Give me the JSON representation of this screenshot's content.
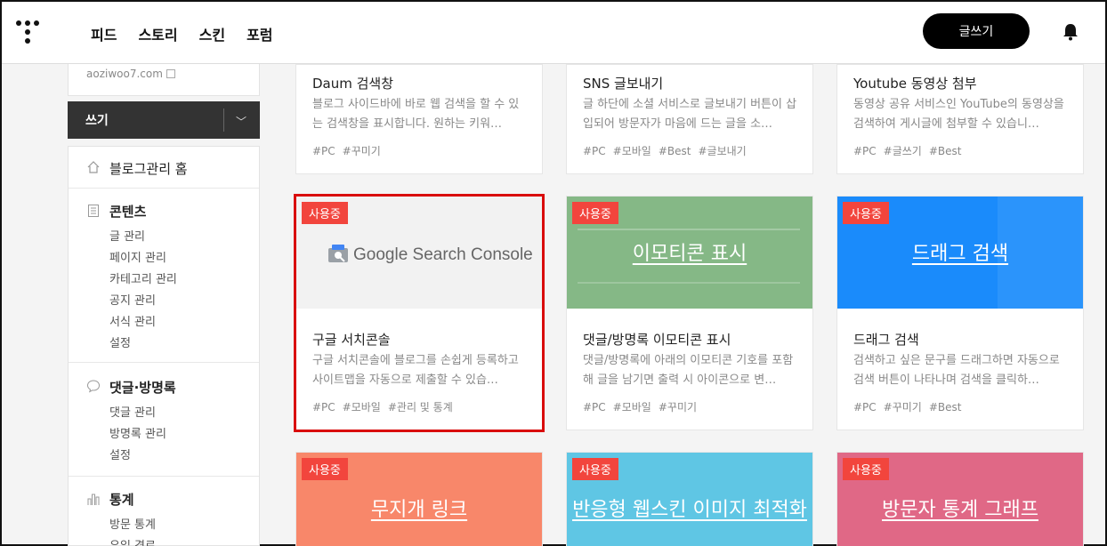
{
  "header": {
    "nav": [
      "피드",
      "스토리",
      "스킨",
      "포럼"
    ],
    "write_button": "글쓰기"
  },
  "sidebar": {
    "blog_url": "aoziwoo7.com",
    "write_menu": "쓰기",
    "home": "블로그관리 홈",
    "content": {
      "title": "콘텐츠",
      "items": [
        "글 관리",
        "페이지 관리",
        "카테고리 관리",
        "공지 관리",
        "서식 관리",
        "설정"
      ]
    },
    "comments": {
      "title": "댓글·방명록",
      "items": [
        "댓글 관리",
        "방명록 관리",
        "설정"
      ]
    },
    "stats": {
      "title": "통계",
      "items": [
        "방문 통계",
        "유입 경로"
      ]
    }
  },
  "badge_label": "사용중",
  "cards_top": [
    {
      "title": "Daum 검색창",
      "desc": "블로그 사이드바에 바로 웹 검색을 할 수 있는 검색창을 표시합니다. 원하는 키워…",
      "tags": [
        "#PC",
        "#꾸미기"
      ]
    },
    {
      "title": "SNS 글보내기",
      "desc": "글 하단에 소셜 서비스로 글보내기 버튼이 삽입되어 방문자가 마음에 드는 글을 소…",
      "tags": [
        "#PC",
        "#모바일",
        "#Best",
        "#글보내기"
      ]
    },
    {
      "title": "Youtube 동영상 첨부",
      "desc": "동영상 공유 서비스인 YouTube의 동영상을 검색하여 게시글에 첨부할 수 있습니…",
      "tags": [
        "#PC",
        "#글쓰기",
        "#Best"
      ]
    }
  ],
  "cards_mid": [
    {
      "thumb": "Google Search Console",
      "title": "구글 서치콘솔",
      "desc": "구글 서치콘솔에 블로그를 손쉽게 등록하고 사이트맵을 자동으로 제출할 수 있습…",
      "tags": [
        "#PC",
        "#모바일",
        "#관리 및 통계"
      ]
    },
    {
      "thumb": "이모티콘 표시",
      "title": "댓글/방명록 이모티콘 표시",
      "desc": "댓글/방명록에 아래의 이모티콘 기호를 포함해 글을 남기면 출력 시 아이콘으로 변…",
      "tags": [
        "#PC",
        "#모바일",
        "#꾸미기"
      ]
    },
    {
      "thumb": "드래그 검색",
      "title": "드래그 검색",
      "desc": "검색하고 싶은 문구를 드래그하면 자동으로 검색 버튼이 나타나며 검색을 클릭하…",
      "tags": [
        "#PC",
        "#꾸미기",
        "#Best"
      ]
    }
  ],
  "cards_bottom": [
    {
      "thumb": "무지개 링크"
    },
    {
      "thumb": "반응형 웹스킨 이미지 최적화"
    },
    {
      "thumb": "방문자 통계 그래프"
    }
  ],
  "colors": {
    "emoticon": "#85b886",
    "drag": "#1a8bfb",
    "rainbow": "#f8876a",
    "responsive": "#5fc6e4",
    "visitor": "#e06886",
    "badge": "#f2453d",
    "selected_border": "#d90c0c"
  }
}
